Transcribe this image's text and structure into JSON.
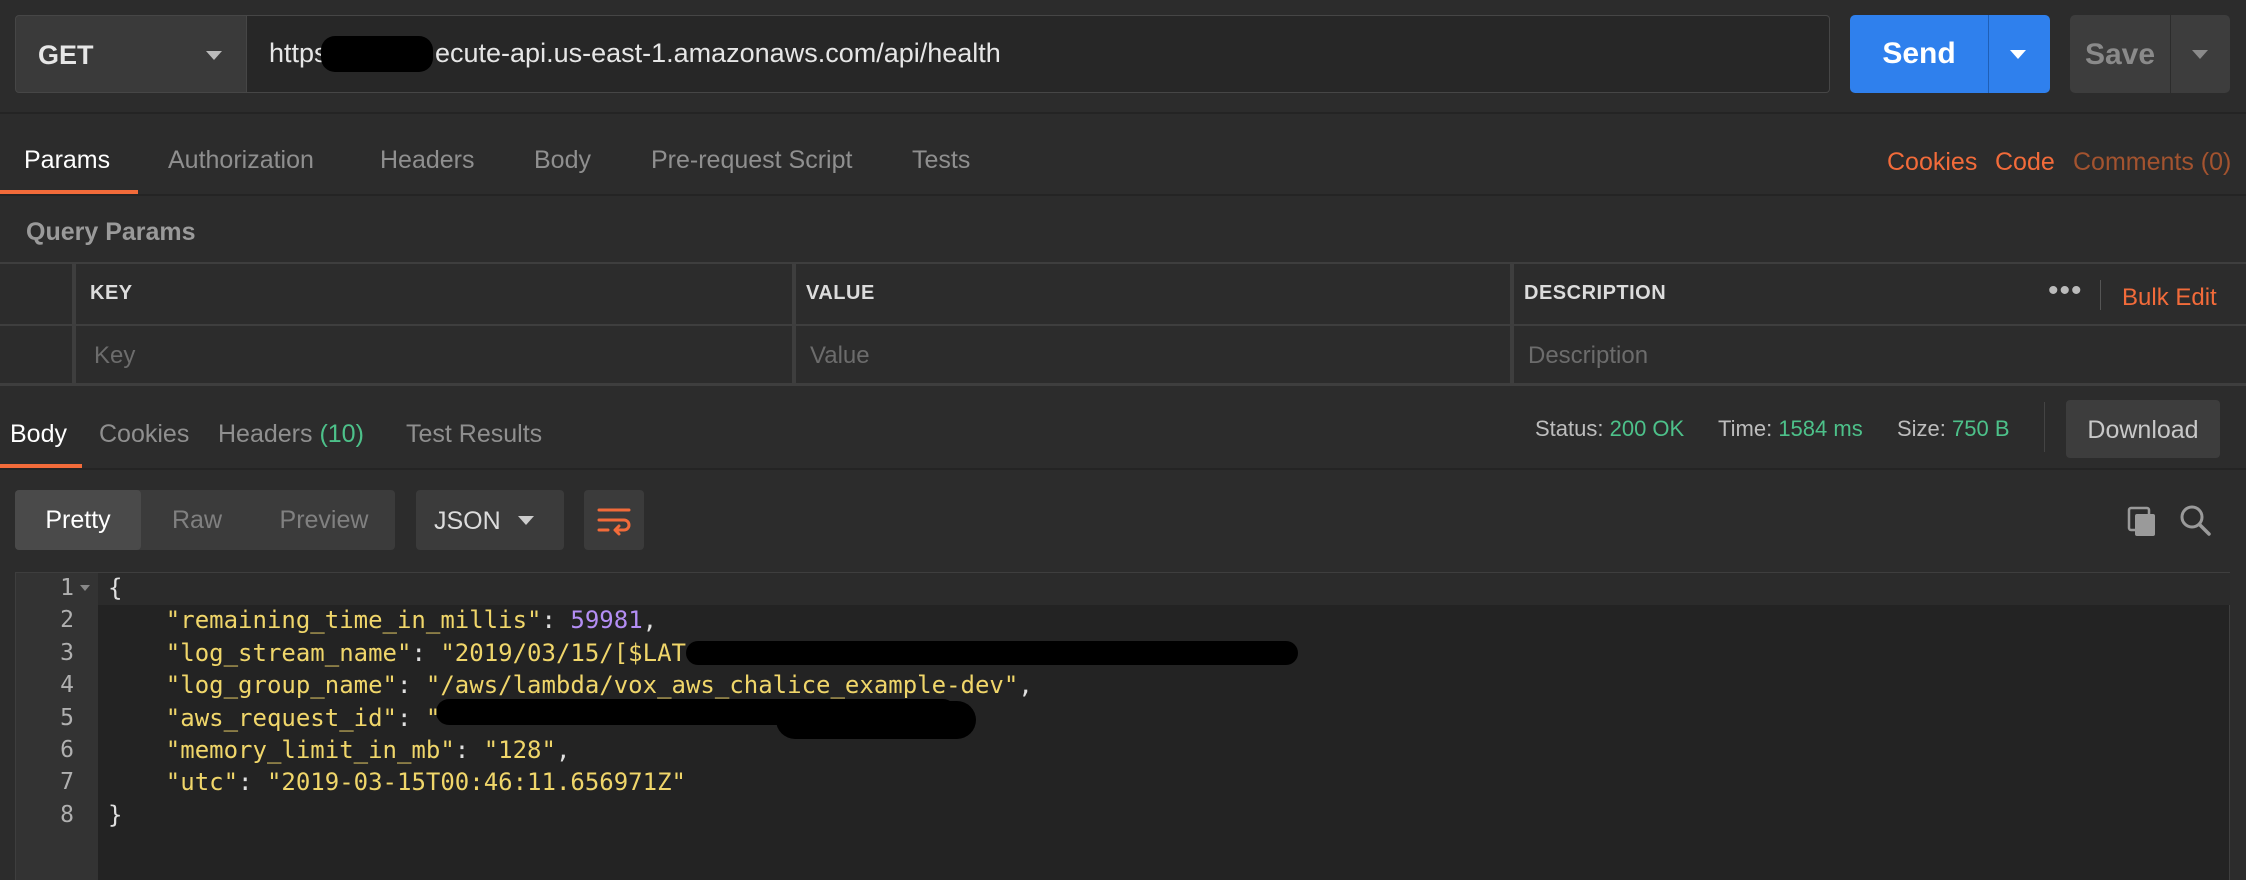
{
  "request": {
    "method": "GET",
    "url_prefix": "https:/",
    "url_suffix": "ecute-api.us-east-1.amazonaws.com/api/health",
    "send_label": "Send",
    "save_label": "Save"
  },
  "request_tabs": [
    "Params",
    "Authorization",
    "Headers",
    "Body",
    "Pre-request Script",
    "Tests"
  ],
  "request_links": {
    "cookies": "Cookies",
    "code": "Code",
    "comments": "Comments (0)"
  },
  "query_params": {
    "title": "Query Params",
    "columns": [
      "KEY",
      "VALUE",
      "DESCRIPTION"
    ],
    "placeholders": [
      "Key",
      "Value",
      "Description"
    ],
    "more": "•••",
    "bulk_edit": "Bulk Edit"
  },
  "response": {
    "tabs": [
      "Body",
      "Cookies",
      "Headers",
      "Test Results"
    ],
    "headers_count": "(10)",
    "status_label": "Status:",
    "status_value": "200 OK",
    "time_label": "Time:",
    "time_value": "1584 ms",
    "size_label": "Size:",
    "size_value": "750 B",
    "download": "Download"
  },
  "body_view": {
    "modes": [
      "Pretty",
      "Raw",
      "Preview"
    ],
    "format": "JSON"
  },
  "code_lines": [
    {
      "n": "1",
      "parts": [
        [
          "pun",
          "{"
        ]
      ]
    },
    {
      "n": "2",
      "parts": [
        [
          "pun",
          "    "
        ],
        [
          "kstr",
          "\"remaining_time_in_millis\""
        ],
        [
          "pun",
          ": "
        ],
        [
          "num",
          "59981"
        ],
        [
          "pun",
          ","
        ]
      ]
    },
    {
      "n": "3",
      "parts": [
        [
          "pun",
          "    "
        ],
        [
          "kstr",
          "\"log_stream_name\""
        ],
        [
          "pun",
          ": "
        ],
        [
          "kstr",
          "\"2019/03/15/[$LAT"
        ]
      ]
    },
    {
      "n": "4",
      "parts": [
        [
          "pun",
          "    "
        ],
        [
          "kstr",
          "\"log_group_name\""
        ],
        [
          "pun",
          ": "
        ],
        [
          "kstr",
          "\"/aws/lambda/vox_aws_chalice_example-dev\""
        ],
        [
          "pun",
          ","
        ]
      ]
    },
    {
      "n": "5",
      "parts": [
        [
          "pun",
          "    "
        ],
        [
          "kstr",
          "\"aws_request_id\""
        ],
        [
          "pun",
          ": "
        ],
        [
          "kstr",
          "\""
        ]
      ]
    },
    {
      "n": "6",
      "parts": [
        [
          "pun",
          "    "
        ],
        [
          "kstr",
          "\"memory_limit_in_mb\""
        ],
        [
          "pun",
          ": "
        ],
        [
          "kstr",
          "\"128\""
        ],
        [
          "pun",
          ","
        ]
      ]
    },
    {
      "n": "7",
      "parts": [
        [
          "pun",
          "    "
        ],
        [
          "kstr",
          "\"utc\""
        ],
        [
          "pun",
          ": "
        ],
        [
          "kstr",
          "\"2019-03-15T00:46:11.656971Z\""
        ]
      ]
    },
    {
      "n": "8",
      "parts": [
        [
          "pun",
          "}"
        ]
      ]
    }
  ],
  "colors": {
    "accent": "#f26b3a",
    "send": "#2f80ed",
    "success": "#4dc18a",
    "string": "#f0d66a",
    "number": "#b48ef5"
  },
  "icons": [
    "chevron-down-icon",
    "wrap-lines-icon",
    "copy-icon",
    "search-icon"
  ]
}
